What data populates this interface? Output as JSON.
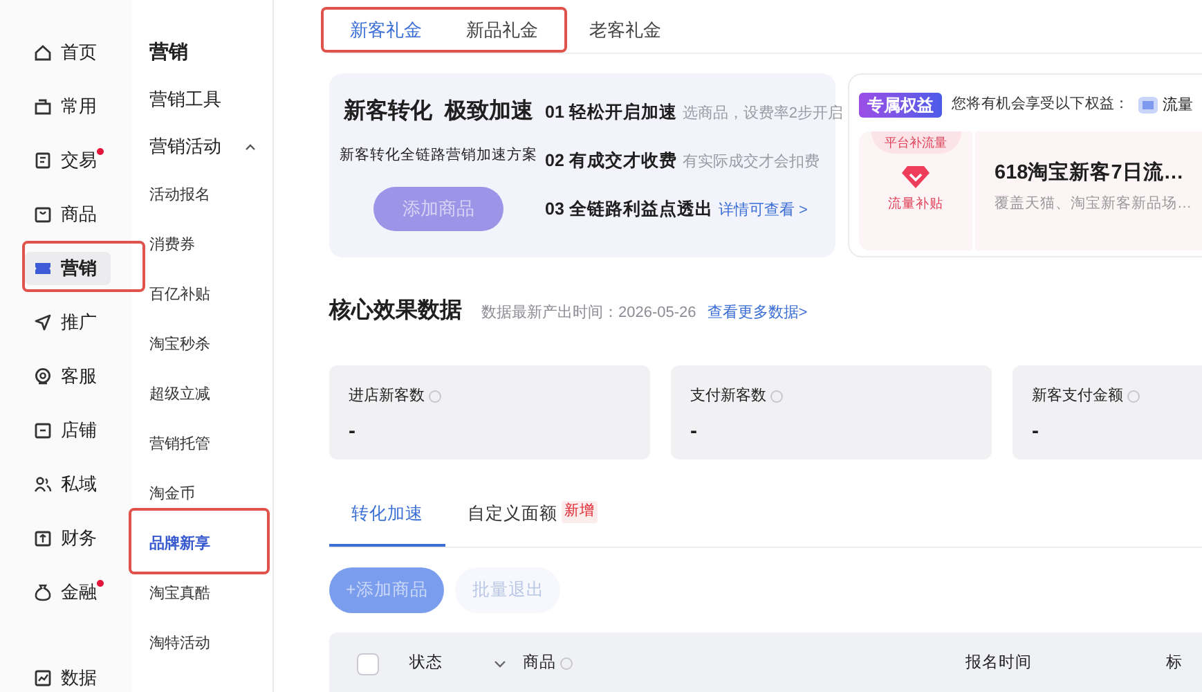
{
  "nav": {
    "items": [
      {
        "label": "首页",
        "selected": false,
        "dot": false,
        "highlighted": false
      },
      {
        "label": "常用",
        "selected": false,
        "dot": false,
        "highlighted": false
      },
      {
        "label": "交易",
        "selected": false,
        "dot": true,
        "highlighted": false
      },
      {
        "label": "商品",
        "selected": false,
        "dot": false,
        "highlighted": false
      },
      {
        "label": "营销",
        "selected": true,
        "dot": false,
        "highlighted": true
      },
      {
        "label": "推广",
        "selected": false,
        "dot": false,
        "highlighted": false
      },
      {
        "label": "客服",
        "selected": false,
        "dot": false,
        "highlighted": false
      },
      {
        "label": "店铺",
        "selected": false,
        "dot": false,
        "highlighted": false
      },
      {
        "label": "私域",
        "selected": false,
        "dot": false,
        "highlighted": false
      },
      {
        "label": "财务",
        "selected": false,
        "dot": false,
        "highlighted": false
      },
      {
        "label": "金融",
        "selected": false,
        "dot": true,
        "highlighted": false
      },
      {
        "label": "数据",
        "selected": false,
        "dot": false,
        "highlighted": false
      }
    ]
  },
  "submenu": {
    "title": "营销",
    "groups": [
      {
        "label": "营销工具",
        "expanded": false
      },
      {
        "label": "营销活动",
        "expanded": true,
        "items": [
          {
            "label": "活动报名",
            "selected": false,
            "highlighted": false
          },
          {
            "label": "消费券",
            "selected": false,
            "highlighted": false
          },
          {
            "label": "百亿补贴",
            "selected": false,
            "highlighted": false
          },
          {
            "label": "淘宝秒杀",
            "selected": false,
            "highlighted": false
          },
          {
            "label": "超级立减",
            "selected": false,
            "highlighted": false
          },
          {
            "label": "营销托管",
            "selected": false,
            "highlighted": false
          },
          {
            "label": "淘金币",
            "selected": false,
            "highlighted": false
          },
          {
            "label": "品牌新享",
            "selected": true,
            "highlighted": true
          },
          {
            "label": "淘宝真酷",
            "selected": false,
            "highlighted": false
          },
          {
            "label": "淘特活动",
            "selected": false,
            "highlighted": false
          }
        ]
      }
    ]
  },
  "tabs": [
    {
      "label": "新客礼金",
      "selected": true,
      "highlighted": true
    },
    {
      "label": "新品礼金",
      "selected": false,
      "highlighted": true
    },
    {
      "label": "老客礼金",
      "selected": false,
      "highlighted": false
    }
  ],
  "promo": {
    "title": "新客**转化**  极致加速",
    "subtitle": "新客转化全链路营销加速方案",
    "button": "添加商品",
    "steps": [
      {
        "title": "01 轻松开启加速",
        "note": "选商品，设费率2步开启",
        "kind": "note"
      },
      {
        "title": "02 有成交才收费",
        "note": "有实际成交才会扣费",
        "kind": "note"
      },
      {
        "title": "03 全链路利益点透出",
        "note": "详情可查看 >",
        "kind": "link"
      }
    ]
  },
  "benefits": {
    "badge": "专属权益",
    "intro": "您将有机会享受以下权益：",
    "chip": "流量",
    "card": {
      "ribbon": "平台补流量",
      "icon_label": "流量补贴",
      "title": "618淘宝新客7日流…",
      "desc": "覆盖天猫、淘宝新客新品场…"
    }
  },
  "core": {
    "title": "核心效果数据",
    "updated": "数据最新产出时间：2026-05-26",
    "link": "查看更多数据>",
    "stats": [
      {
        "label": "进店新客数",
        "value": "-"
      },
      {
        "label": "支付新客数",
        "value": "-"
      },
      {
        "label": "新客支付金额",
        "value": "-"
      }
    ]
  },
  "sub_tabs": [
    {
      "label": "转化加速",
      "selected": true
    },
    {
      "label": "自定义面额",
      "selected": false,
      "badge": "新增"
    }
  ],
  "actions": [
    {
      "label": "+添加商品",
      "kind": "primary",
      "disabled": true
    },
    {
      "label": "批量退出",
      "kind": "secondary",
      "disabled": true
    }
  ],
  "table": {
    "select_all": {
      "checked": false
    },
    "columns": [
      {
        "label": "状态",
        "kind": "dropdown"
      },
      {
        "label": "商品",
        "kind": "help"
      },
      {
        "label": "报名时间",
        "kind": "plain"
      },
      {
        "label": "标",
        "kind": "plain"
      }
    ]
  }
}
